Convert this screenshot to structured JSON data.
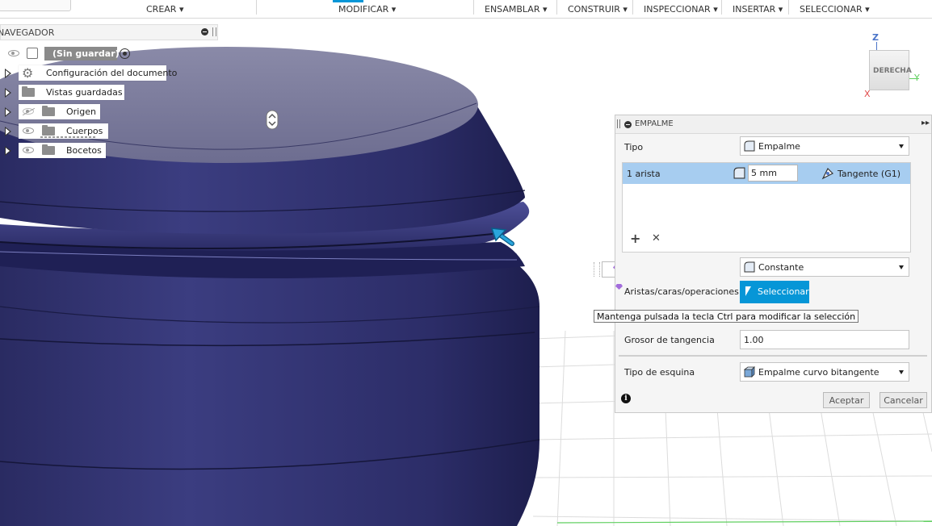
{
  "toolbar": {
    "menus": [
      "CREAR",
      "MODIFICAR",
      "ENSAMBLAR",
      "CONSTRUIR",
      "INSPECCIONAR",
      "INSERTAR",
      "SELECCIONAR"
    ]
  },
  "browser": {
    "title": "NAVEGADOR",
    "root_label": "(Sin guardar)",
    "items": [
      {
        "label": "Configuración del documento",
        "icon": "gear-icon"
      },
      {
        "label": "Vistas guardadas",
        "icon": "folder-icon"
      },
      {
        "label": "Origen",
        "icon": "folder-icon",
        "visible": false
      },
      {
        "label": "Cuerpos",
        "icon": "folder-icon",
        "visible": true
      },
      {
        "label": "Bocetos",
        "icon": "folder-icon",
        "visible": true
      }
    ]
  },
  "viewcube": {
    "face": "DERECHA",
    "axis_z": "Z",
    "axis_x": "X",
    "axis_y": "Y"
  },
  "dialog": {
    "title": "EMPALME",
    "type_label": "Tipo",
    "type_value": "Empalme",
    "edge": {
      "name": "1 arista",
      "radius": "5 mm",
      "continuity": "Tangente (G1)"
    },
    "radius_type": "Constante",
    "select_label": "Aristas/caras/operaciones",
    "select_button": "Seleccionar",
    "tangency_label": "Grosor de tangencia",
    "tangency_value": "1.00",
    "corner_label": "Tipo de esquina",
    "corner_value": "Empalme curvo bitangente",
    "ok": "Aceptar",
    "cancel": "Cancelar"
  },
  "float_input": {
    "value": "5"
  },
  "tooltip": "Mantenga pulsada la tecla Ctrl para modificar la selección",
  "colors": {
    "accent": "#0696d7",
    "body": "#2e2f6a",
    "highlight_row": "#a7cdf0"
  }
}
